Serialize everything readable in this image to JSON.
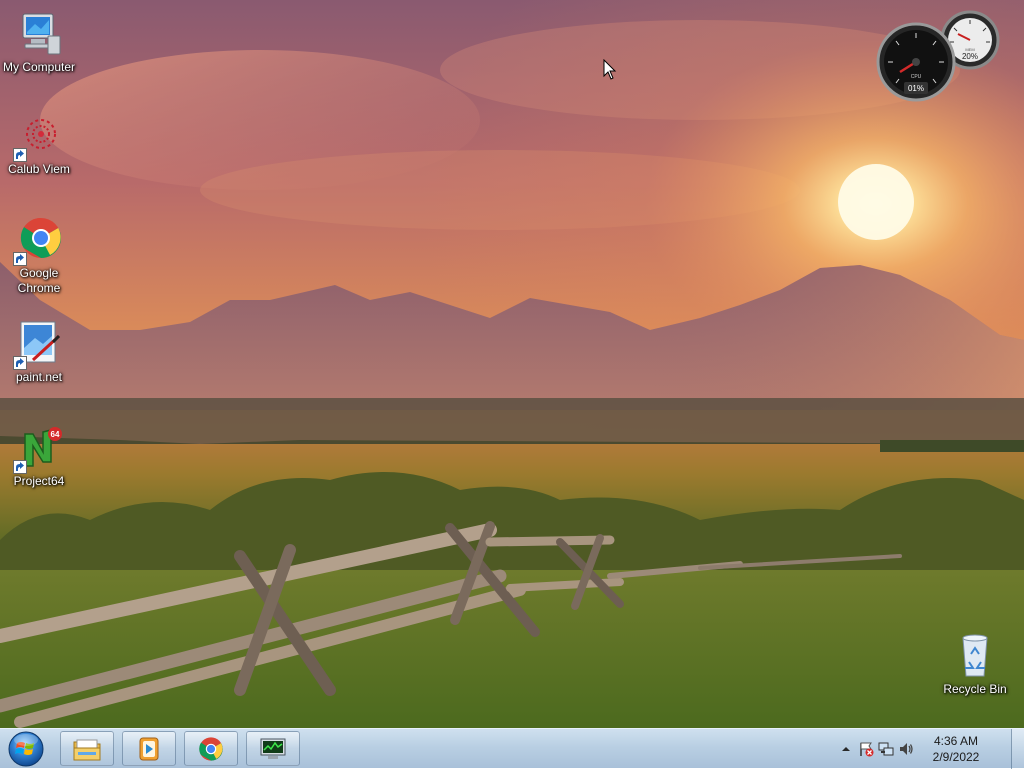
{
  "desktop": {
    "icons": [
      {
        "label": "My Computer",
        "icon": "computer-icon"
      },
      {
        "label": "Calub Viem",
        "icon": "calub-viem-icon"
      },
      {
        "label": "Google\nChrome",
        "icon": "chrome-icon"
      },
      {
        "label": "paint.net",
        "icon": "paintnet-icon"
      },
      {
        "label": "Project64",
        "icon": "project64-icon"
      },
      {
        "label": "Recycle Bin",
        "icon": "recycle-bin-icon"
      }
    ],
    "gadget": {
      "cpu_label": "CPU",
      "cpu_value": "01%",
      "mem_label": "MEM",
      "mem_value": "20%"
    }
  },
  "taskbar": {
    "start_icon": "windows-start-orb",
    "pinned": [
      {
        "name": "file-explorer",
        "icon": "folder-icon"
      },
      {
        "name": "media-player",
        "icon": "media-player-icon"
      },
      {
        "name": "google-chrome",
        "icon": "chrome-icon"
      },
      {
        "name": "task-manager",
        "icon": "monitor-icon"
      }
    ],
    "tray": {
      "icons": [
        "show-hidden-icons-chevron",
        "action-center-flag-icon",
        "network-icon",
        "volume-icon"
      ]
    },
    "clock": {
      "time": "4:36 AM",
      "date": "2/9/2022"
    }
  }
}
